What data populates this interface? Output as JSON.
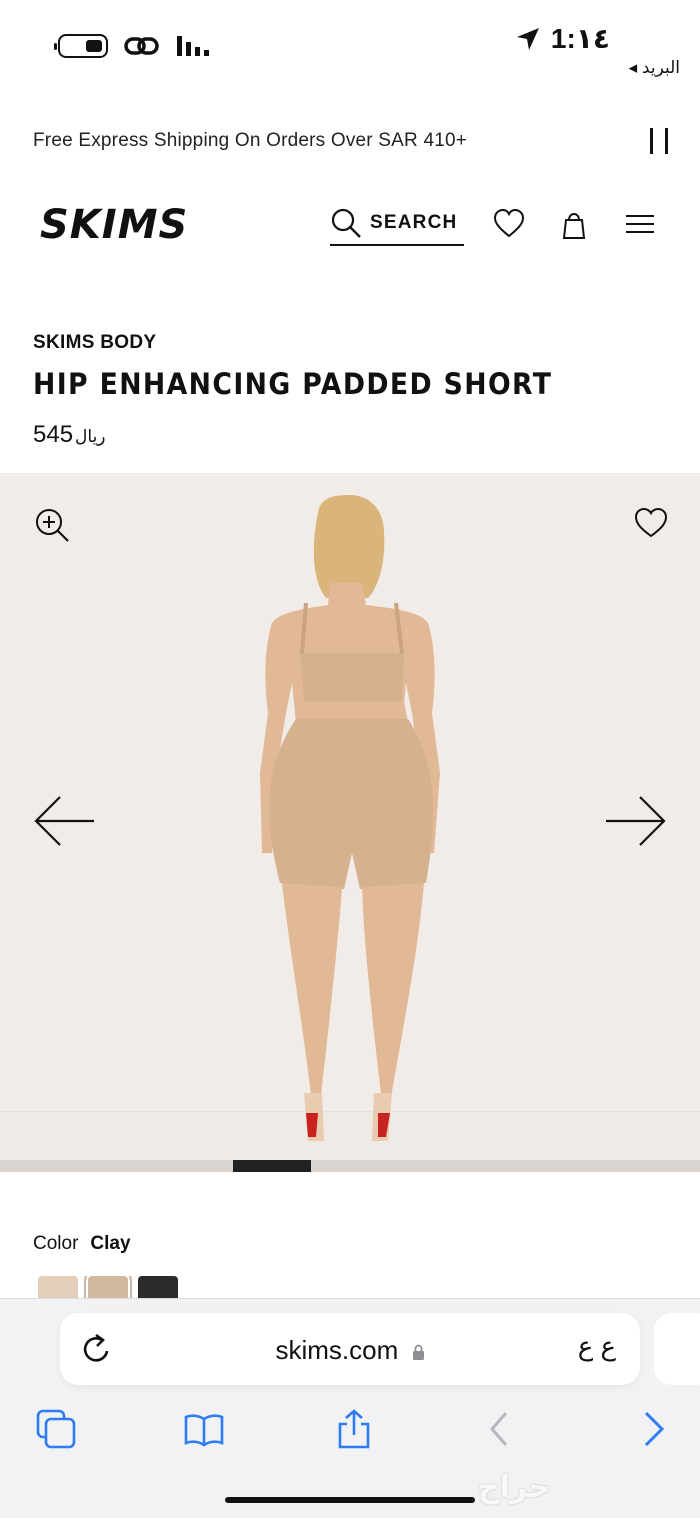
{
  "status_bar": {
    "time": "1:١٤",
    "back_label": "◂ البريد",
    "icons": [
      "battery-icon",
      "link-icon",
      "signal-icon",
      "location-arrow-icon"
    ]
  },
  "promo": {
    "text": "Free Express Shipping On Orders Over SAR 410+",
    "pause_icon": "pause-icon"
  },
  "header": {
    "logo_text": "SKIMS",
    "search_label": "SEARCH",
    "icons": [
      "search-icon",
      "heart-icon",
      "bag-icon",
      "menu-icon"
    ]
  },
  "product": {
    "brand": "SKIMS BODY",
    "name": "HIP ENHANCING PADDED SHORT",
    "price": "545",
    "currency": "ريال"
  },
  "gallery": {
    "icons": [
      "zoom-in-icon",
      "heart-icon",
      "arrow-left-icon",
      "arrow-right-icon"
    ],
    "progress_position": 0.333,
    "progress_fraction": 0.111
  },
  "color": {
    "label": "Color",
    "value": "Clay",
    "swatches": [
      "#e4cdb9",
      "#d2b89f",
      "#2b2b2b"
    ]
  },
  "browser": {
    "url": "skims.com",
    "aa_label": "ع ع",
    "icons": [
      "reload-icon",
      "lock-icon",
      "tabs-icon",
      "bookmarks-icon",
      "share-icon",
      "back-icon",
      "forward-icon"
    ]
  },
  "watermark": "حراج",
  "colors": {
    "accent_blue": "#2f7bf6",
    "disabled_gray": "#b8b8bc",
    "gallery_bg": "#f1ece8",
    "skin": "#e1b996",
    "garment": "#d6b18e"
  }
}
